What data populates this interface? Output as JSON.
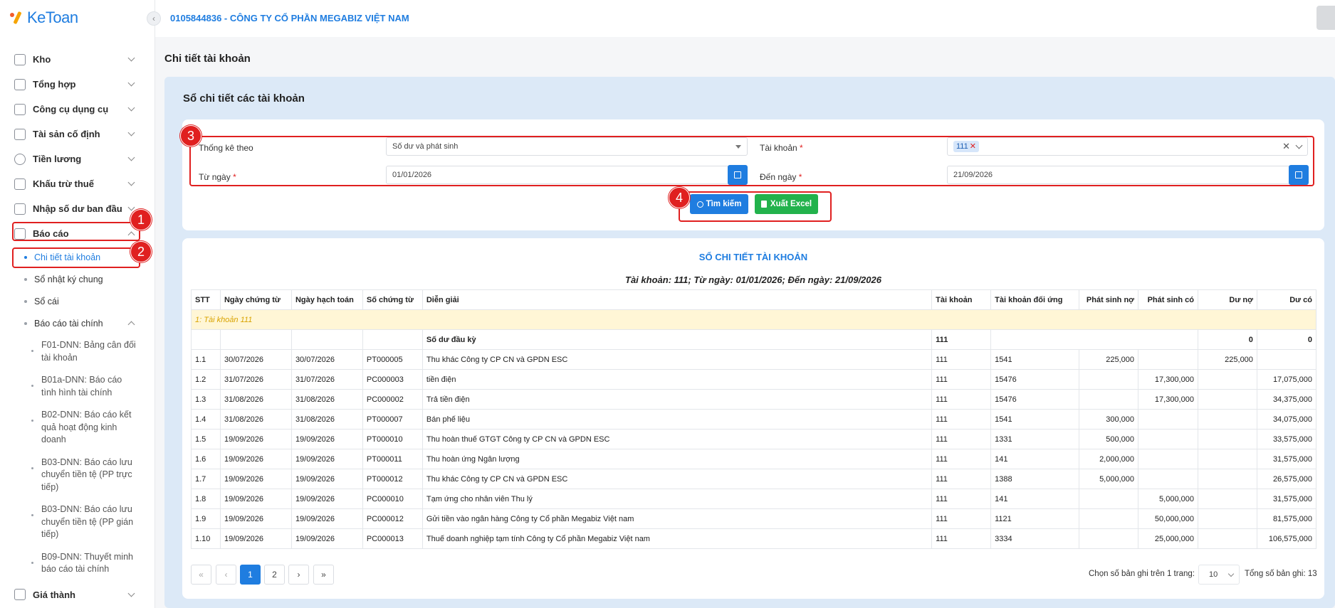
{
  "app": {
    "logo_text": "KeToan"
  },
  "header": {
    "company": "0105844836 - CÔNG TY CỔ PHẦN MEGABIZ VIỆT NAM"
  },
  "sidebar": {
    "items": [
      {
        "label": "Kho",
        "icon": "warehouse-icon"
      },
      {
        "label": "Tổng hợp",
        "icon": "chart-line-icon"
      },
      {
        "label": "Công cụ dụng cụ",
        "icon": "toolbox-icon"
      },
      {
        "label": "Tài sản cố định",
        "icon": "car-icon"
      },
      {
        "label": "Tiền lương",
        "icon": "dollar-icon"
      },
      {
        "label": "Khấu trừ thuế",
        "icon": "bank-icon"
      },
      {
        "label": "Nhập số dư ban đầu",
        "icon": "edit-icon"
      },
      {
        "label": "Báo cáo",
        "icon": "report-icon"
      }
    ],
    "report_sub": {
      "active": "Chi tiết tài khoản",
      "journal": "Sổ nhật ký chung",
      "ledger": "Sổ cái",
      "financial": "Báo cáo tài chính"
    },
    "financial_sub": [
      "F01-DNN: Bảng cân đối tài khoản",
      "B01a-DNN: Báo cáo tình hình tài chính",
      "B02-DNN: Báo cáo kết quả hoạt động kinh doanh",
      "B03-DNN: Báo cáo lưu chuyển tiền tệ (PP trực tiếp)",
      "B03-DNN: Báo cáo lưu chuyển tiền tệ (PP gián tiếp)",
      "B09-DNN: Thuyết minh báo cáo tài chính"
    ],
    "last_item": "Giá thành"
  },
  "page": {
    "title": "Chi tiết tài khoản",
    "section": "Sổ chi tiết các tài khoản"
  },
  "filters": {
    "stat_label": "Thống kê theo",
    "stat_value": "Số dư và phát sinh",
    "account_label": "Tài khoản",
    "account_tag": "111",
    "from_label": "Từ ngày",
    "from_value": "01/01/2026",
    "to_label": "Đến ngày",
    "to_value": "21/09/2026",
    "required": "*",
    "search_button": "Tìm kiếm",
    "excel_button": "Xuất Excel"
  },
  "annotations": [
    "1",
    "2",
    "3",
    "4"
  ],
  "report": {
    "title": "SỔ CHI TIẾT TÀI KHOẢN",
    "subtitle": "Tài khoản: 111; Từ ngày: 01/01/2026; Đến ngày: 21/09/2026",
    "columns": [
      "STT",
      "Ngày chứng từ",
      "Ngày hạch toán",
      "Số chứng từ",
      "Diễn giải",
      "Tài khoản",
      "Tài khoản đối ứng",
      "Phát sinh nợ",
      "Phát sinh có",
      "Dư nợ",
      "Dư có"
    ],
    "group": "1: Tài khoản 111",
    "opening": {
      "label": "Số dư đầu kỳ",
      "account": "111",
      "du_no": "0",
      "du_co": "0"
    },
    "rows": [
      [
        "1.1",
        "30/07/2026",
        "30/07/2026",
        "PT000005",
        "Thu khác Công ty CP CN và GPDN ESC",
        "111",
        "1541",
        "225,000",
        "",
        "225,000",
        ""
      ],
      [
        "1.2",
        "31/07/2026",
        "31/07/2026",
        "PC000003",
        "tiền điện",
        "111",
        "15476",
        "",
        "17,300,000",
        "",
        "17,075,000"
      ],
      [
        "1.3",
        "31/08/2026",
        "31/08/2026",
        "PC000002",
        "Trả tiền điện",
        "111",
        "15476",
        "",
        "17,300,000",
        "",
        "34,375,000"
      ],
      [
        "1.4",
        "31/08/2026",
        "31/08/2026",
        "PT000007",
        "Bán phế liệu",
        "111",
        "1541",
        "300,000",
        "",
        "",
        "34,075,000"
      ],
      [
        "1.5",
        "19/09/2026",
        "19/09/2026",
        "PT000010",
        "Thu hoàn thuế GTGT Công ty CP CN và GPDN ESC",
        "111",
        "1331",
        "500,000",
        "",
        "",
        "33,575,000"
      ],
      [
        "1.6",
        "19/09/2026",
        "19/09/2026",
        "PT000011",
        "Thu hoàn ứng Ngân lượng",
        "111",
        "141",
        "2,000,000",
        "",
        "",
        "31,575,000"
      ],
      [
        "1.7",
        "19/09/2026",
        "19/09/2026",
        "PT000012",
        "Thu khác Công ty CP CN và GPDN ESC",
        "111",
        "1388",
        "5,000,000",
        "",
        "",
        "26,575,000"
      ],
      [
        "1.8",
        "19/09/2026",
        "19/09/2026",
        "PC000010",
        "Tạm ứng cho nhân viên Thu lý",
        "111",
        "141",
        "",
        "5,000,000",
        "",
        "31,575,000"
      ],
      [
        "1.9",
        "19/09/2026",
        "19/09/2026",
        "PC000012",
        "Gửi tiền vào ngân hàng Công ty Cổ phần Megabiz Việt nam",
        "111",
        "1121",
        "",
        "50,000,000",
        "",
        "81,575,000"
      ],
      [
        "1.10",
        "19/09/2026",
        "19/09/2026",
        "PC000013",
        "Thuế doanh nghiệp tạm tính Công ty Cổ phần Megabiz Việt nam",
        "111",
        "3334",
        "",
        "25,000,000",
        "",
        "106,575,000"
      ]
    ]
  },
  "pagination": {
    "first": "«",
    "prev": "‹",
    "pages": [
      "1",
      "2"
    ],
    "next": "›",
    "last": "»",
    "per_page_label": "Chọn số bản ghi trên 1 trang:",
    "per_page": "10",
    "total_label": "Tổng số bản ghi:",
    "total": "13"
  },
  "colors": {
    "accent": "#1f7de0",
    "success": "#22b24c",
    "annotation": "#e02020"
  }
}
